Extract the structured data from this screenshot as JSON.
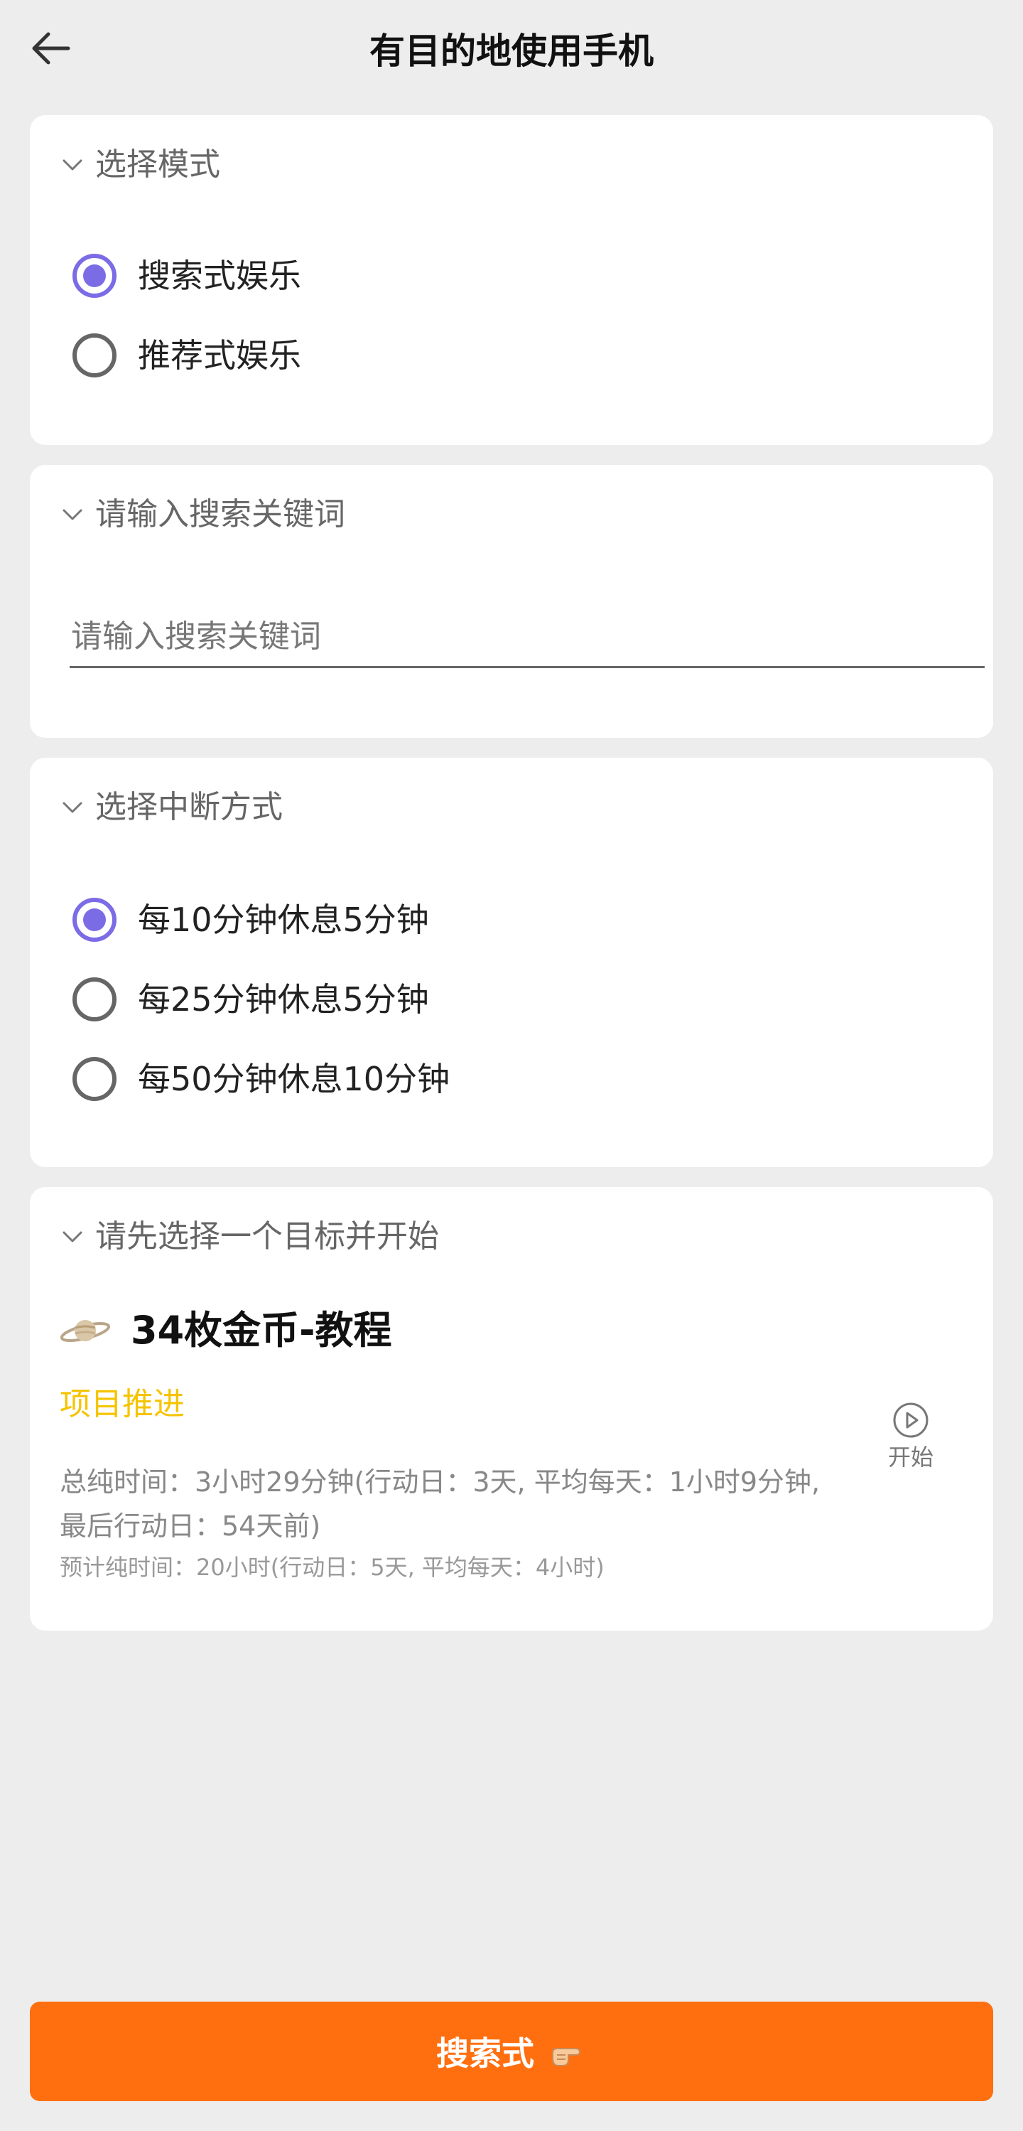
{
  "header": {
    "title": "有目的地使用手机"
  },
  "mode_section": {
    "title": "选择模式",
    "options": [
      {
        "label": "搜索式娱乐",
        "checked": true
      },
      {
        "label": "推荐式娱乐",
        "checked": false
      }
    ]
  },
  "keyword_section": {
    "title": "请输入搜索关键词",
    "placeholder": "请输入搜索关键词",
    "value": ""
  },
  "interrupt_section": {
    "title": "选择中断方式",
    "options": [
      {
        "label": "每10分钟休息5分钟",
        "checked": true
      },
      {
        "label": "每25分钟休息5分钟",
        "checked": false
      },
      {
        "label": "每50分钟休息10分钟",
        "checked": false
      }
    ]
  },
  "goal_section": {
    "title": "请先选择一个目标并开始",
    "goal": {
      "icon": "planet-icon",
      "name": "34枚金币-教程",
      "category": "项目推进",
      "total_time_text": "总纯时间：3小时29分钟(行动日：3天, 平均每天：1小时9分钟, 最后行动日：54天前)",
      "estimate_text": "预计纯时间：20小时(行动日：5天, 平均每天：4小时)",
      "start_label": "开始"
    }
  },
  "bottom_button": {
    "label": "搜索式",
    "icon": "pointing-hand-icon"
  },
  "colors": {
    "accent": "#7b6ce6",
    "primary_button": "#ff6f0f",
    "category": "#f5c400"
  }
}
